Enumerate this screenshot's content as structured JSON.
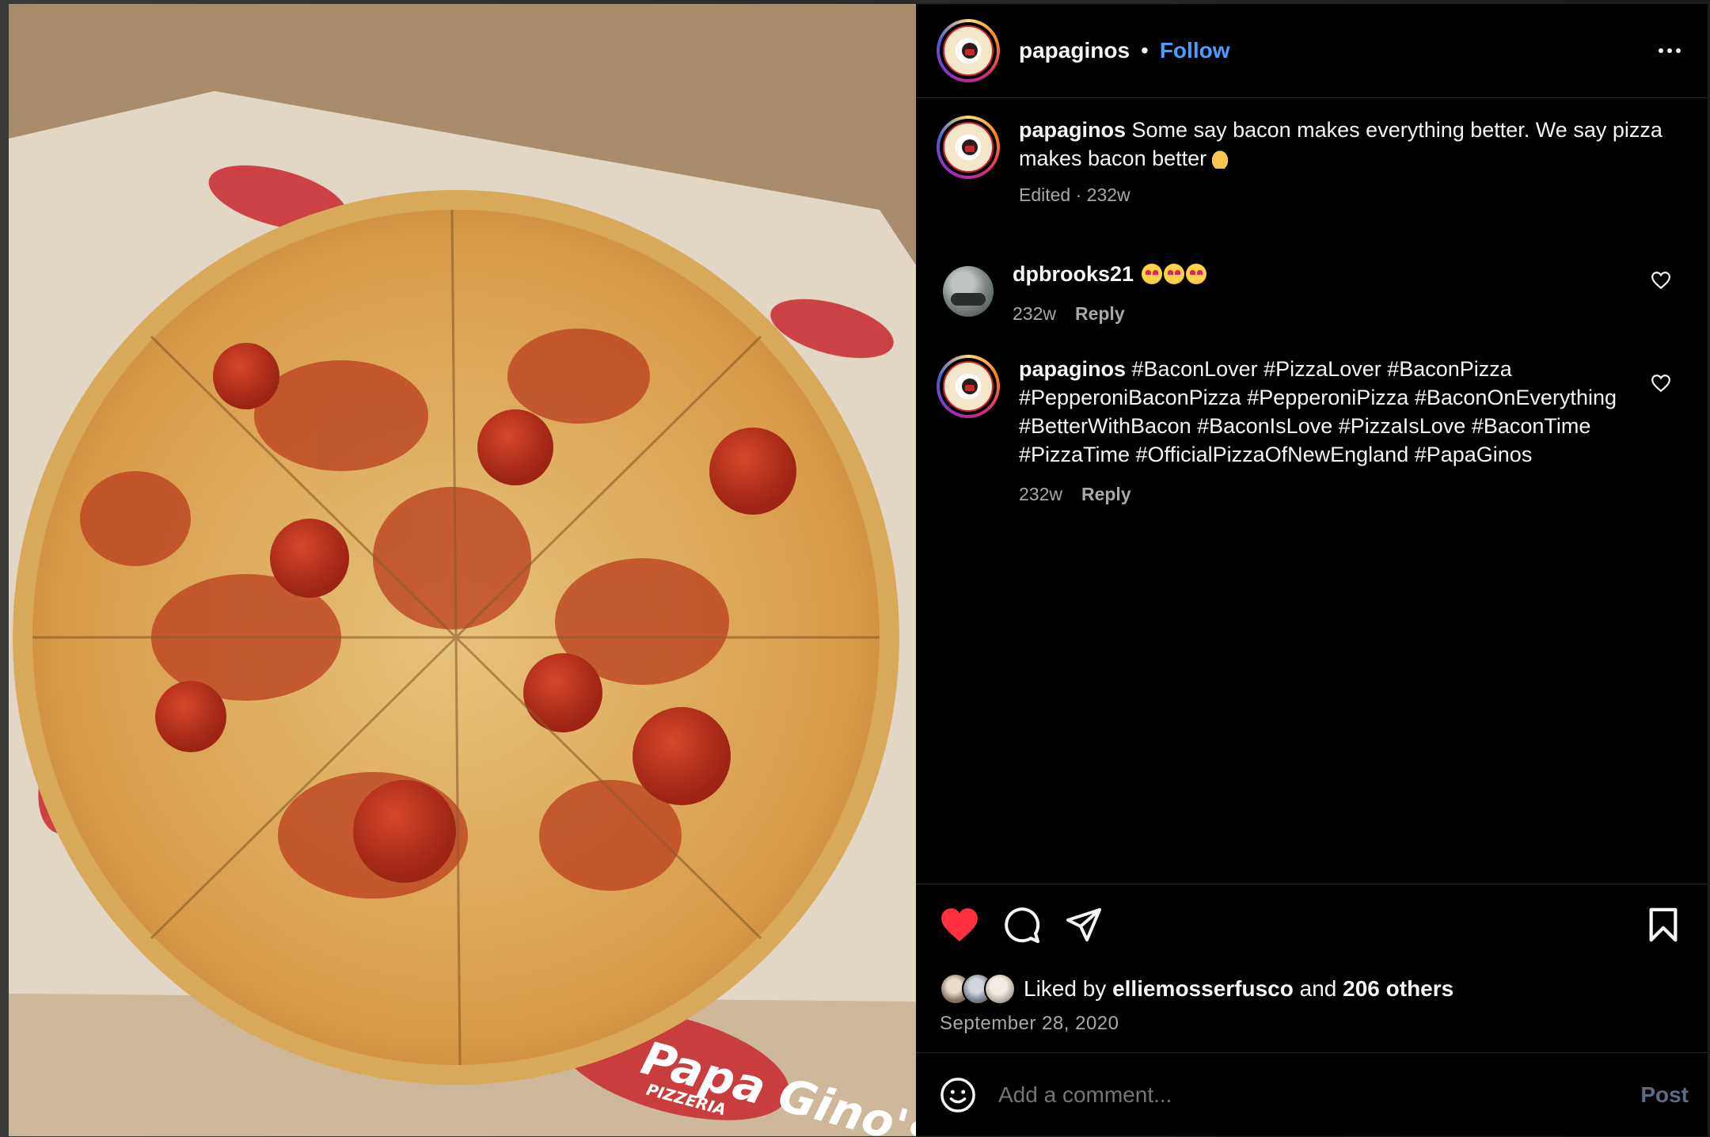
{
  "header": {
    "username": "papaginos",
    "separator": "•",
    "follow_label": "Follow"
  },
  "caption": {
    "username": "papaginos",
    "text": "Some say bacon makes everything better. We say pizza makes bacon better",
    "meta": "Edited · 232w"
  },
  "comments": [
    {
      "username": "dpbrooks21",
      "text": "",
      "time": "232w",
      "reply_label": "Reply"
    },
    {
      "username": "papaginos",
      "text": "#BaconLover #PizzaLover #BaconPizza #PepperoniBaconPizza #PepperoniPizza #BaconOnEverything #BetterWithBacon #BaconIsLove #PizzaIsLove #BaconTime #PizzaTime #OfficialPizzaOfNewEngland #PapaGinos",
      "time": "232w",
      "reply_label": "Reply"
    }
  ],
  "likes": {
    "prefix": "Liked by",
    "user": "elliemosserfusco",
    "conjunction": "and",
    "others": "206 others"
  },
  "date": "September 28, 2020",
  "add_comment": {
    "placeholder": "Add a comment...",
    "post_label": "Post"
  },
  "media": {
    "box_text": "Papa Gino's",
    "box_subtext": "PIZZERIA"
  },
  "colors": {
    "follow": "#4a9eff",
    "liked_heart": "#ff3040",
    "post_disabled": "#5b6d85",
    "secondary_text": "#a8a8a8"
  },
  "icons": {
    "more": "more-options-icon",
    "like": "heart-filled-icon",
    "comment": "comment-icon",
    "share": "share-icon",
    "save": "bookmark-icon",
    "emoji": "emoji-icon"
  }
}
